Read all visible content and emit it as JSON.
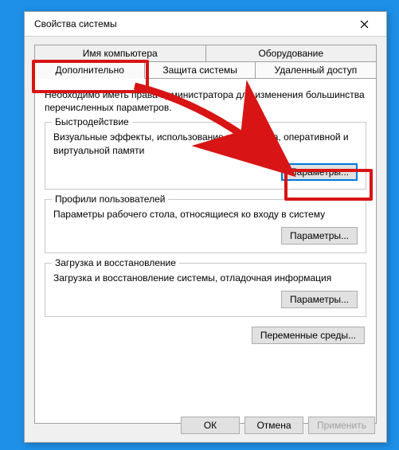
{
  "title": "Свойства системы",
  "tabs": {
    "row1": [
      "Имя компьютера",
      "Оборудование"
    ],
    "row2": [
      "Дополнительно",
      "Защита системы",
      "Удаленный доступ"
    ]
  },
  "intro": "Необходимо иметь права администратора для изменения большинства перечисленных параметров.",
  "groups": {
    "performance": {
      "title": "Быстродействие",
      "desc": "Визуальные эффекты, использование процессора, оперативной и виртуальной памяти",
      "button": "Параметры..."
    },
    "profiles": {
      "title": "Профили пользователей",
      "desc": "Параметры рабочего стола, относящиеся ко входу в систему",
      "button": "Параметры..."
    },
    "startup": {
      "title": "Загрузка и восстановление",
      "desc": "Загрузка и восстановление системы, отладочная информация",
      "button": "Параметры..."
    }
  },
  "env_button": "Переменные среды...",
  "buttons": {
    "ok": "ОК",
    "cancel": "Отмена",
    "apply": "Применить"
  }
}
